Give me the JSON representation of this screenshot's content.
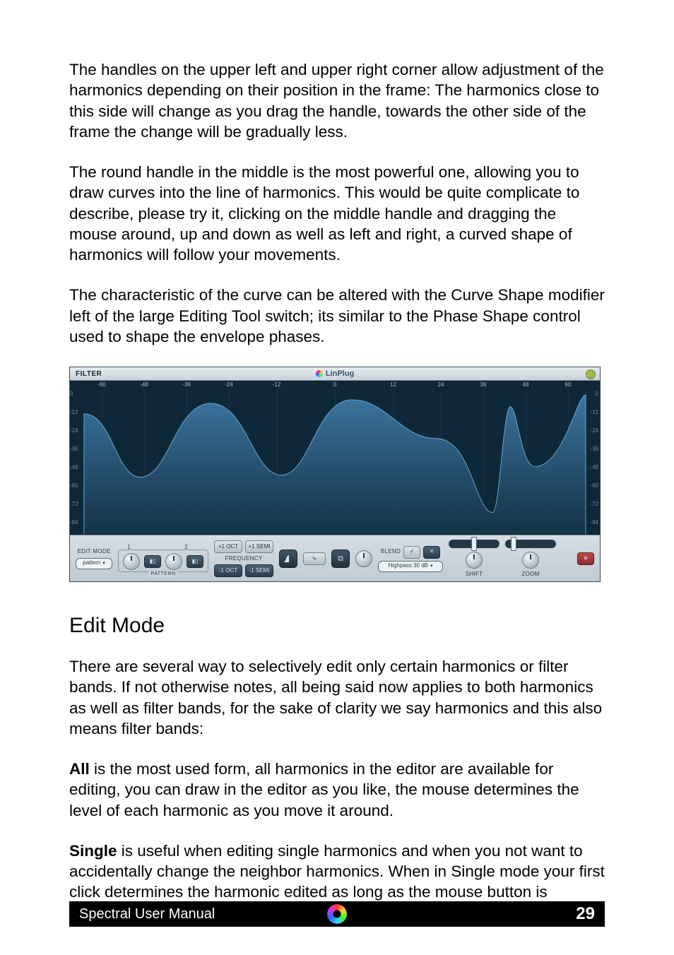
{
  "paragraphs": {
    "p1": "The handles on the upper left and upper right corner allow adjustment of the harmonics depending on their position in the frame: The harmonics close to this side will change as you drag the handle, towards the other side of the frame the change will be gradually less.",
    "p2": "The round handle in the middle is the most powerful one, allowing you to draw curves into the line of harmonics. This would be quite complicate to describe, please try it, clicking on the middle handle and dragging the mouse around, up and down as well as left and right, a curved shape of harmonics will follow your movements.",
    "p3": "The characteristic of the curve can be altered with the Curve Shape modifier left of the large Editing Tool switch; its similar to the Phase Shape control used to shape the envelope phases.",
    "h1": "Edit Mode",
    "p4": "There are several way to selectively edit only certain harmonics or filter bands. If not otherwise notes, all being said now applies to both harmonics as well as filter bands, for the sake of clarity we say harmonics and this also means filter bands:",
    "p5a": "All",
    "p5b": " is the most used form, all harmonics in the editor are available for editing, you can draw in the editor as you like, the mouse determines the level of each harmonic as you move it around.",
    "p6a": "Single",
    "p6b": " is useful when editing single harmonics and when you not want to accidentally change the neighbor harmonics. When in Single mode your first click determines the harmonic edited as long as the mouse button is"
  },
  "filter": {
    "title": "FILTER",
    "brand": "LinPlug",
    "ruler": [
      "-60",
      "-48",
      "-36",
      "-24",
      "-12",
      "0",
      "12",
      "24",
      "36",
      "48",
      "60"
    ],
    "yticksL": [
      "0",
      "-12",
      "-24",
      "-36",
      "-48",
      "-60",
      "-72",
      "-84"
    ],
    "yticksR": [
      "0",
      "-12",
      "-24",
      "-36",
      "-48",
      "-60",
      "-72",
      "-84"
    ],
    "controls": {
      "editmode_label": "EDIT MODE",
      "editmode_value": "pattern",
      "pattern_label": "PATTERN",
      "num1": "1",
      "num2": "2",
      "freq_label": "FREQUENCY",
      "freq_up_oct": "+1 OCT",
      "freq_up_semi": "+1 SEMI",
      "freq_dn_oct": "-1 OCT",
      "freq_dn_semi": "-1 SEMI",
      "blend_label": "BLEND",
      "highpass": "Highpass 30 dB",
      "shift_label": "SHIFT",
      "zoom_label": "ZOOM"
    }
  },
  "footer": {
    "title": "Spectral User Manual",
    "page": "29"
  }
}
